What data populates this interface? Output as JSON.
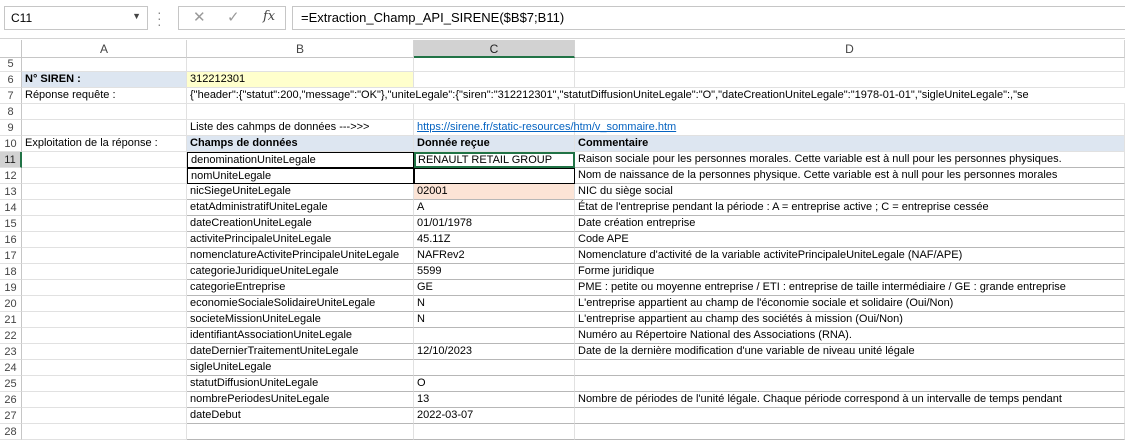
{
  "formula_bar": {
    "name_box": "C11",
    "formula": "=Extraction_Champ_API_SIRENE($B$7;B11)"
  },
  "columns": [
    "A",
    "B",
    "C",
    "D"
  ],
  "rows": {
    "r6": {
      "num": "6",
      "a": "N° SIREN :",
      "b": "312212301"
    },
    "r7": {
      "num": "7",
      "a": "Réponse requête :",
      "b": "{\"header\":{\"statut\":200,\"message\":\"OK\"},\"uniteLegale\":{\"siren\":\"312212301\",\"statutDiffusionUniteLegale\":\"O\",\"dateCreationUniteLegale\":\"1978-01-01\",\"sigleUniteLegale\":,\"se"
    },
    "r8": {
      "num": "8"
    },
    "r9": {
      "num": "9",
      "b": "Liste des cahmps de données --->>>",
      "c": "https://sirene.fr/static-resources/htm/v_sommaire.htm"
    },
    "r10": {
      "num": "10",
      "a": "Exploitation de la réponse :",
      "b": "Champs de données",
      "c": "Donnée reçue",
      "d": "Commentaire"
    }
  },
  "table_rows": [
    {
      "num": "11",
      "field": "denominationUniteLegale",
      "value": "RENAULT RETAIL GROUP",
      "comment": "Raison sociale pour les personnes morales. Cette variable est à null pour les personnes physiques."
    },
    {
      "num": "12",
      "field": "nomUniteLegale",
      "value": "",
      "comment": "Nom de naissance de la personnes physique. Cette variable est à null pour les personnes morales"
    },
    {
      "num": "13",
      "field": "nicSiegeUniteLegale",
      "value": "02001",
      "comment": "NIC du siège social"
    },
    {
      "num": "14",
      "field": "etatAdministratifUniteLegale",
      "value": "A",
      "comment": "État de l'entreprise pendant la période : A = entreprise active ; C = entreprise cessée"
    },
    {
      "num": "15",
      "field": "dateCreationUniteLegale",
      "value": "01/01/1978",
      "comment": "Date création entreprise"
    },
    {
      "num": "16",
      "field": "activitePrincipaleUniteLegale",
      "value": "45.11Z",
      "comment": "Code APE"
    },
    {
      "num": "17",
      "field": "nomenclatureActivitePrincipaleUniteLegale",
      "value": "NAFRev2",
      "comment": "Nomenclature d'activité de la variable activitePrincipaleUniteLegale (NAF/APE)"
    },
    {
      "num": "18",
      "field": "categorieJuridiqueUniteLegale",
      "value": "5599",
      "comment": "Forme juridique"
    },
    {
      "num": "19",
      "field": "categorieEntreprise",
      "value": "GE",
      "comment": "PME : petite ou moyenne entreprise / ETI : entreprise de taille intermédiaire / GE : grande entreprise"
    },
    {
      "num": "20",
      "field": "economieSocialeSolidaireUniteLegale",
      "value": "N",
      "comment": "L'entreprise appartient au champ de l'économie sociale et solidaire (Oui/Non)"
    },
    {
      "num": "21",
      "field": "societeMissionUniteLegale",
      "value": "N",
      "comment": "L'entreprise appartient au champ des sociétés à mission (Oui/Non)"
    },
    {
      "num": "22",
      "field": "identifiantAssociationUniteLegale",
      "value": "",
      "comment": "Numéro au Répertoire National des Associations (RNA)."
    },
    {
      "num": "23",
      "field": "dateDernierTraitementUniteLegale",
      "value": "12/10/2023",
      "comment": "Date de la dernière modification d'une variable de niveau unité légale"
    },
    {
      "num": "24",
      "field": "sigleUniteLegale",
      "value": "",
      "comment": ""
    },
    {
      "num": "25",
      "field": "statutDiffusionUniteLegale",
      "value": "O",
      "comment": ""
    },
    {
      "num": "26",
      "field": "nombrePeriodesUniteLegale",
      "value": "13",
      "comment": "Nombre de périodes de l'unité légale. Chaque période correspond à un intervalle de temps pendant"
    },
    {
      "num": "27",
      "field": "dateDebut",
      "value": "2022-03-07",
      "comment": ""
    },
    {
      "num": "28",
      "field": "",
      "value": "",
      "comment": ""
    }
  ]
}
